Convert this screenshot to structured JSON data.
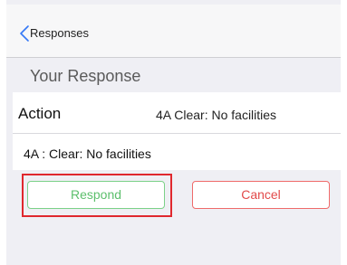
{
  "navbar": {
    "back_label": "Responses"
  },
  "section": {
    "title": "Your Response"
  },
  "card": {
    "action_label": "Action",
    "action_value": "4A Clear: No facilities",
    "detail": "4A : Clear: No facilities"
  },
  "buttons": {
    "respond_label": "Respond",
    "cancel_label": "Cancel"
  },
  "icons": {
    "back": "chevron-left-icon"
  },
  "colors": {
    "accent_blue": "#3478f6",
    "respond_green": "#5cbf6c",
    "cancel_red": "#e24a4a",
    "highlight_red": "#e0282e"
  }
}
